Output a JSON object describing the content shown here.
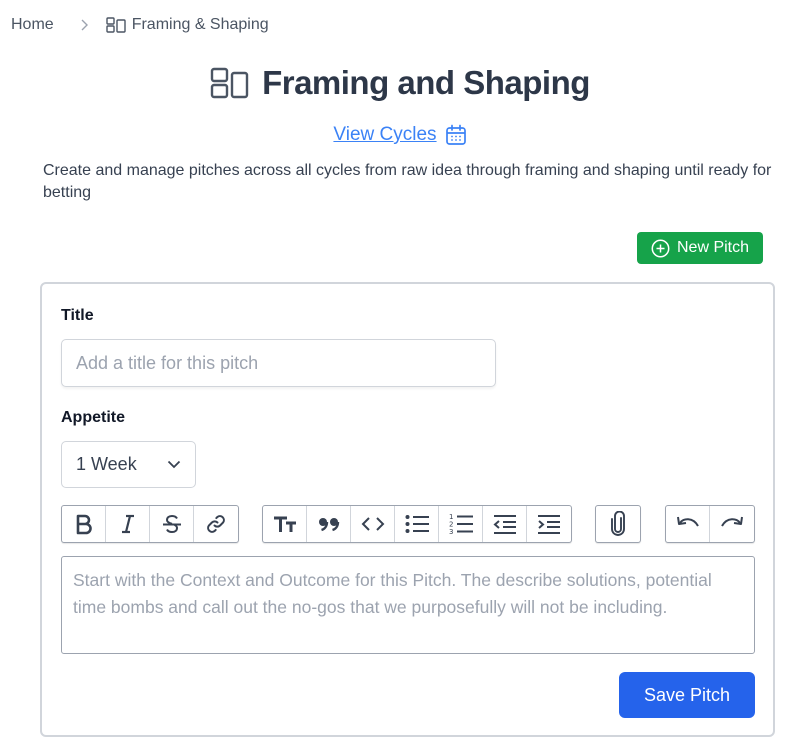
{
  "breadcrumb": {
    "home": "Home",
    "current": "Framing & Shaping",
    "separator_icon": "chevron-right-icon",
    "current_icon": "layout-icon"
  },
  "page": {
    "title": "Framing and Shaping",
    "title_icon": "layout-icon",
    "view_cycles_link": "View Cycles",
    "view_cycles_icon": "calendar-icon",
    "description": "Create and manage pitches across all cycles from raw idea through framing and shaping until ready for betting"
  },
  "actions": {
    "new_pitch": "New Pitch",
    "new_pitch_icon": "plus-circle-icon"
  },
  "form": {
    "title_label": "Title",
    "title_value": "",
    "title_placeholder": "Add a title for this pitch",
    "appetite_label": "Appetite",
    "appetite_value": "1 Week",
    "editor_placeholder": "Start with the Context and Outcome for this Pitch. The describe solutions, potential time bombs and call out the no-gos that we purposefully will not be including.",
    "save_label": "Save Pitch"
  },
  "toolbar": {
    "groups": [
      [
        "bold-icon",
        "italic-icon",
        "strikethrough-icon",
        "link-icon"
      ],
      [
        "heading-icon",
        "quote-icon",
        "code-icon",
        "bullet-list-icon",
        "numbered-list-icon",
        "outdent-icon",
        "indent-icon"
      ],
      [
        "attachment-icon"
      ],
      [
        "undo-icon",
        "redo-icon"
      ]
    ]
  },
  "colors": {
    "primary_blue": "#2563eb",
    "link_blue": "#3b82f6",
    "success_green": "#16a34a",
    "heading": "#2d3748"
  }
}
